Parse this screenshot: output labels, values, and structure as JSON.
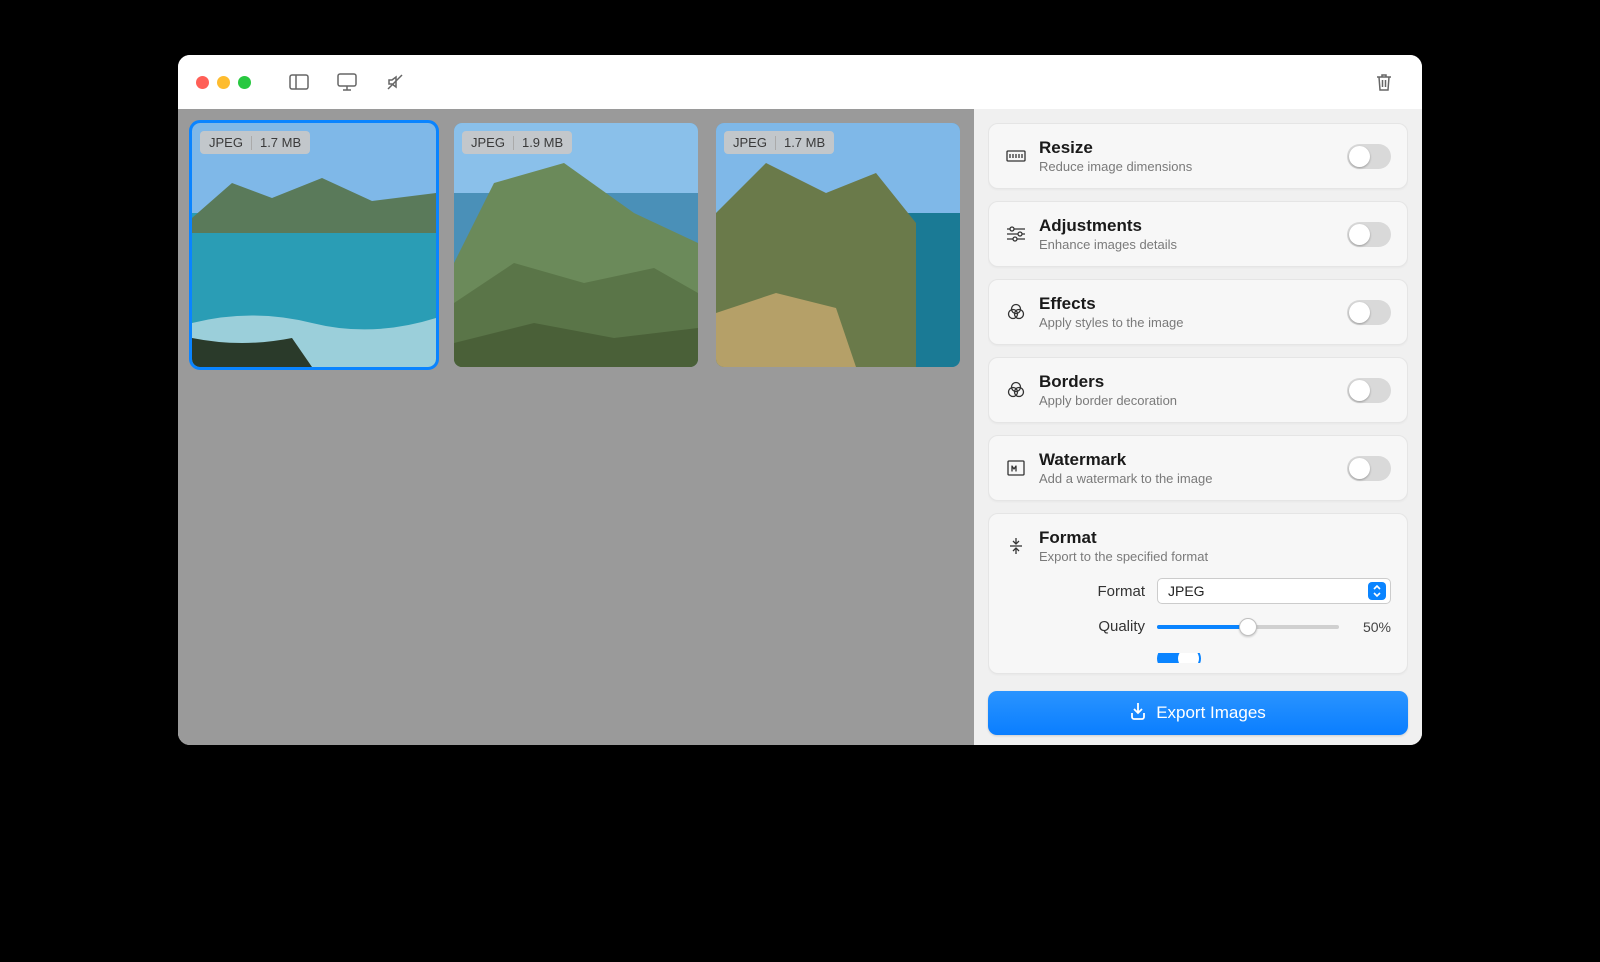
{
  "thumbnails": [
    {
      "format": "JPEG",
      "size": "1.7 MB",
      "selected": true
    },
    {
      "format": "JPEG",
      "size": "1.9 MB",
      "selected": false
    },
    {
      "format": "JPEG",
      "size": "1.7 MB",
      "selected": false
    }
  ],
  "panels": {
    "resize": {
      "title": "Resize",
      "subtitle": "Reduce image dimensions",
      "on": false
    },
    "adjust": {
      "title": "Adjustments",
      "subtitle": "Enhance images details",
      "on": false
    },
    "effects": {
      "title": "Effects",
      "subtitle": "Apply styles to the image",
      "on": false
    },
    "borders": {
      "title": "Borders",
      "subtitle": "Apply border decoration",
      "on": false
    },
    "watermark": {
      "title": "Watermark",
      "subtitle": "Add a watermark to the image",
      "on": false
    },
    "format": {
      "title": "Format",
      "subtitle": "Export to the specified format"
    }
  },
  "format": {
    "label_format": "Format",
    "value_format": "JPEG",
    "label_quality": "Quality",
    "value_quality": "50%",
    "quality_percent": 50
  },
  "export_button": "Export Images"
}
